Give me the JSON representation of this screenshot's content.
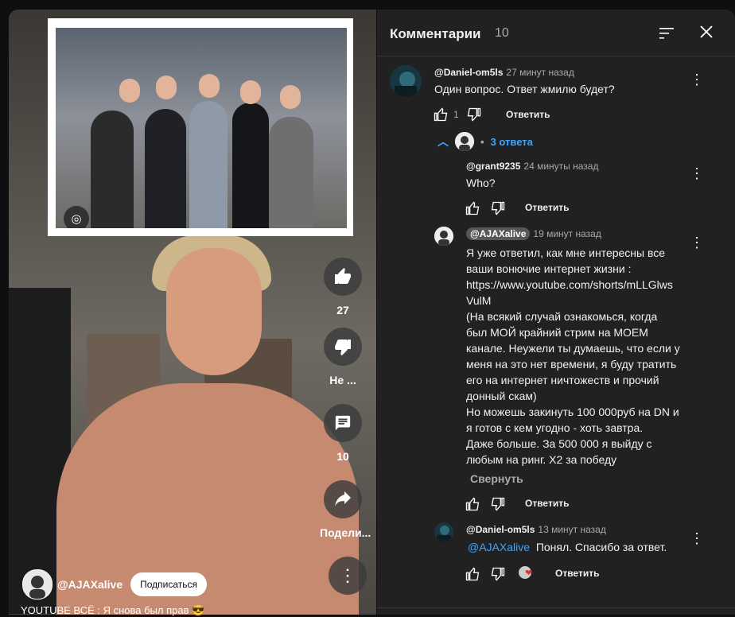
{
  "video": {
    "likes": "27",
    "dislike_label": "Не ...",
    "comments_count": "10",
    "share_label": "Подели...",
    "channel_name": "@AJAXalive",
    "subscribe_label": "Подписаться",
    "title": "YOUTUBE ВСЁ : Я снова был прав 😎"
  },
  "panel": {
    "title": "Комментарии",
    "count": "10"
  },
  "comments": [
    {
      "author": "@Daniel-om5ls",
      "time": "27 минут назад",
      "text": "Один вопрос. Ответ жмилю будет?",
      "likes": "1",
      "reply_label": "Ответить",
      "replies_toggle": "3 ответа"
    }
  ],
  "replies": [
    {
      "author": "@grant9235",
      "time": "24 минуты назад",
      "text": "Who?",
      "reply_label": "Ответить"
    },
    {
      "author": "@AJAXalive",
      "time": "19 минут назад",
      "lines": [
        "Я уже ответил, как мне интересны все",
        "ваши вонючие интернет жизни :",
        "https://www.youtube.com/shorts/mLLGlws",
        "VulM",
        "(На всякий случай ознакомься, когда",
        "был МОЙ крайний стрим на МОЕМ",
        "канале. Неужели ты думаешь, что если у",
        "меня на это нет времени, я буду тратить",
        "его на интернет ничтожеств и прочий",
        "донный скам)",
        "Но можешь закинуть 100 000руб на DN и",
        "я готов с кем угодно - хоть завтра.",
        "Даже больше. За 500 000 я выйду с",
        "любым на ринг. Х2 за победу"
      ],
      "collapse_label": "Свернуть",
      "reply_label": "Ответить"
    },
    {
      "author": "@Daniel-om5ls",
      "time": "13 минут назад",
      "mention": "@AJAXalive",
      "text": "Понял. Спасибо за ответ.",
      "reply_label": "Ответить"
    }
  ]
}
